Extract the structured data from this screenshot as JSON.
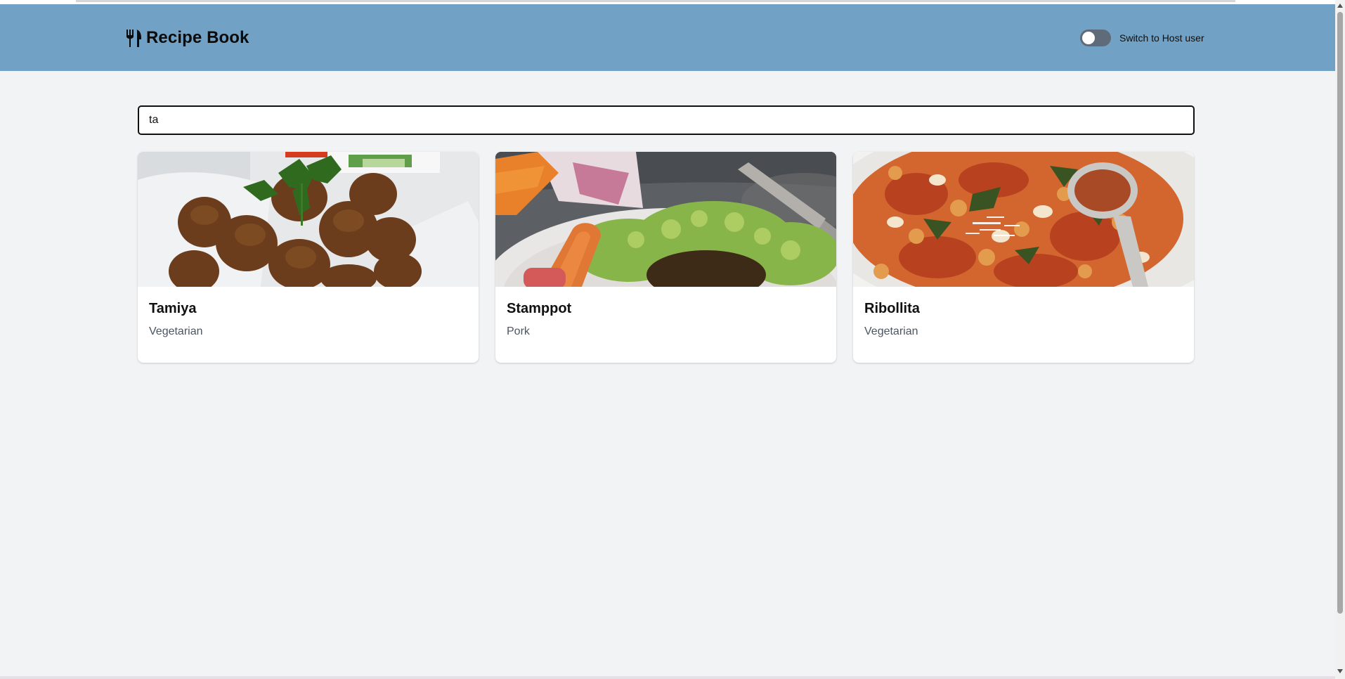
{
  "header": {
    "brand_icon": "fork-knife-icon",
    "title": "Recipe Book",
    "toggle": {
      "label": "Switch to Host user",
      "checked": false
    }
  },
  "search": {
    "value": "ta",
    "placeholder": ""
  },
  "recipes": [
    {
      "name": "Tamiya",
      "category": "Vegetarian"
    },
    {
      "name": "Stamppot",
      "category": "Pork"
    },
    {
      "name": "Ribollita",
      "category": "Vegetarian"
    }
  ],
  "colors": {
    "header_bg": "#71a1c4",
    "page_bg": "#f2f3f5",
    "toggle_off": "#5f6b78"
  }
}
